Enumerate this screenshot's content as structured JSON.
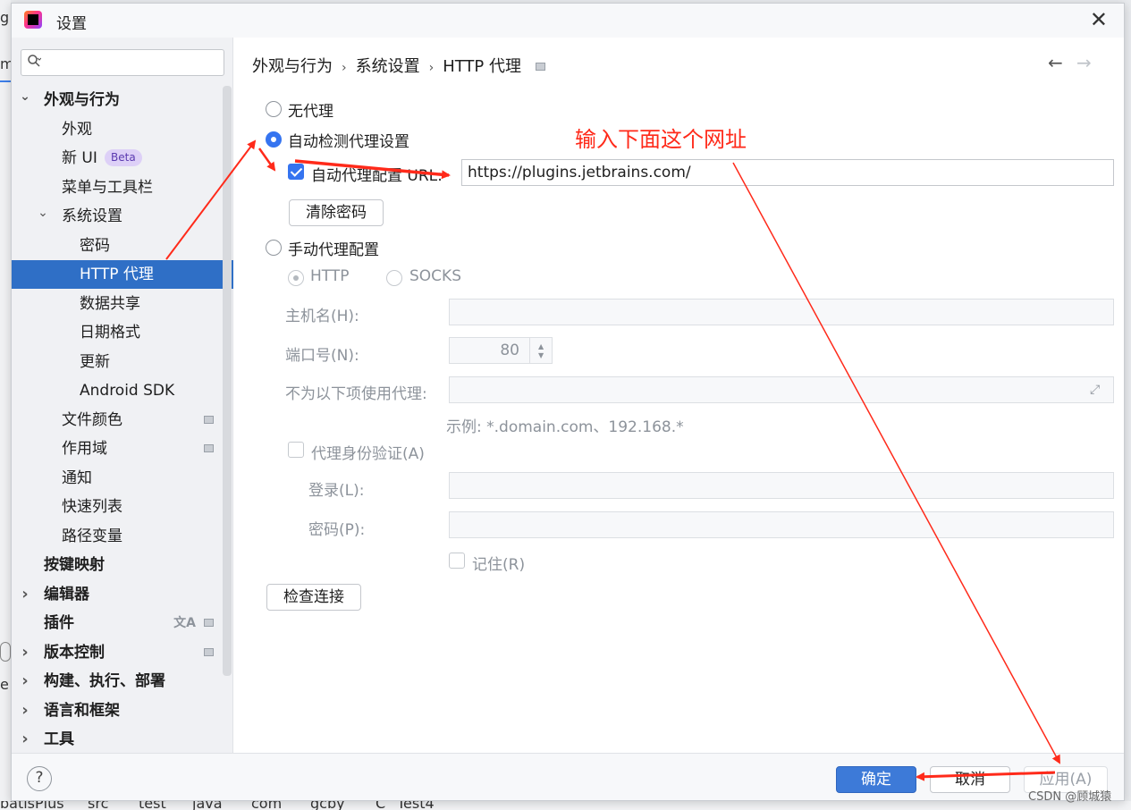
{
  "background": {
    "left_fragments": [
      "g",
      "m",
      "e"
    ],
    "status_path": [
      "batisPlus",
      "src",
      "test",
      "java",
      "com",
      "gcby",
      "Test4"
    ],
    "status_class_icon": "C"
  },
  "dialog": {
    "title": "设置",
    "app_icon": "intellij-idea-icon",
    "close_glyph": "✕"
  },
  "sidebar": {
    "search": {
      "value": "",
      "placeholder": ""
    },
    "items": [
      {
        "label": "外观与行为",
        "chevron": "v",
        "bold": true,
        "level": 0
      },
      {
        "label": "外观",
        "level": 1
      },
      {
        "label": "新 UI",
        "badge": "Beta",
        "level": 1
      },
      {
        "label": "菜单与工具栏",
        "level": 1
      },
      {
        "label": "系统设置",
        "chevron": "v",
        "level": 1
      },
      {
        "label": "密码",
        "level": 2
      },
      {
        "label": "HTTP 代理",
        "level": 2,
        "selected": true
      },
      {
        "label": "数据共享",
        "level": 2
      },
      {
        "label": "日期格式",
        "level": 2
      },
      {
        "label": "更新",
        "level": 2
      },
      {
        "label": "Android SDK",
        "level": 2
      },
      {
        "label": "文件颜色",
        "level": 1,
        "mark": true
      },
      {
        "label": "作用域",
        "level": 1,
        "mark": true
      },
      {
        "label": "通知",
        "level": 1
      },
      {
        "label": "快速列表",
        "level": 1
      },
      {
        "label": "路径变量",
        "level": 1
      },
      {
        "label": "按键映射",
        "bold": true,
        "level": 0
      },
      {
        "label": "编辑器",
        "chevron": ">",
        "bold": true,
        "level": 0
      },
      {
        "label": "插件",
        "bold": true,
        "level": 0,
        "mark": true,
        "translate": true
      },
      {
        "label": "版本控制",
        "chevron": ">",
        "bold": true,
        "level": 0,
        "mark": true
      },
      {
        "label": "构建、执行、部署",
        "chevron": ">",
        "bold": true,
        "level": 0
      },
      {
        "label": "语言和框架",
        "chevron": ">",
        "bold": true,
        "level": 0
      },
      {
        "label": "工具",
        "chevron": ">",
        "bold": true,
        "level": 0
      }
    ]
  },
  "content": {
    "breadcrumb": [
      "外观与行为",
      "系统设置",
      "HTTP 代理"
    ],
    "nav_back": "←",
    "nav_forward": "→",
    "no_proxy_label": "无代理",
    "auto_detect_label": "自动检测代理设置",
    "auto_config_label": "自动代理配置 URL:",
    "auto_config_url": "https://plugins.jetbrains.com/",
    "clear_password_label": "清除密码",
    "manual_label": "手动代理配置",
    "http_label": "HTTP",
    "socks_label": "SOCKS",
    "host_label": "主机名(H):",
    "host_value": "",
    "port_label": "端口号(N):",
    "port_value": "80",
    "no_proxy_for_label": "不为以下项使用代理:",
    "no_proxy_for_value": "",
    "example_text": "示例: *.domain.com、192.168.*",
    "auth_label": "代理身份验证(A)",
    "login_label": "登录(L):",
    "login_value": "",
    "password_label": "密码(P):",
    "password_value": "",
    "remember_label": "记住(R)",
    "check_connection_label": "检查连接"
  },
  "footer": {
    "help": "?",
    "ok": "确定",
    "cancel": "取消",
    "apply": "应用(A)"
  },
  "annotation": {
    "text": "输入下面这个网址",
    "color": "#ff2a1a"
  },
  "watermark": "CSDN @顾城猿"
}
